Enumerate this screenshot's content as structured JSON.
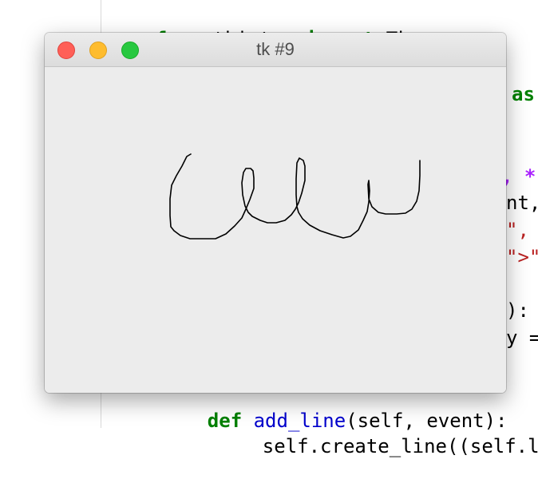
{
  "editor": {
    "lines": [
      {
        "parts": [
          {
            "text": "from",
            "cls": "kw"
          },
          {
            "text": " tkinter ",
            "cls": ""
          },
          {
            "text": "import",
            "cls": "kw"
          },
          {
            "text": " Tk",
            "cls": ""
          }
        ]
      }
    ],
    "right_fragments": [
      {
        "text": "as",
        "cls": "kw"
      },
      {
        "text": ", *",
        "cls": "op"
      },
      {
        "text": "nt,",
        "cls": ""
      },
      {
        "text": "\",",
        "cls": "str"
      },
      {
        "text": "\">\",",
        "cls": "str"
      },
      {
        "text": "):",
        "cls": ""
      },
      {
        "text": "y =",
        "cls": ""
      }
    ],
    "bottom_lines": [
      {
        "parts": [
          {
            "text": "def",
            "cls": "kw"
          },
          {
            "text": " ",
            "cls": ""
          },
          {
            "text": "add_line",
            "cls": "call"
          },
          {
            "text": "(self, event):",
            "cls": ""
          }
        ]
      },
      {
        "parts": [
          {
            "text": "self.create_line((self.l",
            "cls": ""
          }
        ]
      }
    ]
  },
  "window": {
    "title": "tk #9",
    "buttons": {
      "close": "close",
      "minimize": "minimize",
      "maximize": "maximize"
    },
    "drawing": {
      "stroke_color": "#000000",
      "description_strokes": 1
    }
  }
}
